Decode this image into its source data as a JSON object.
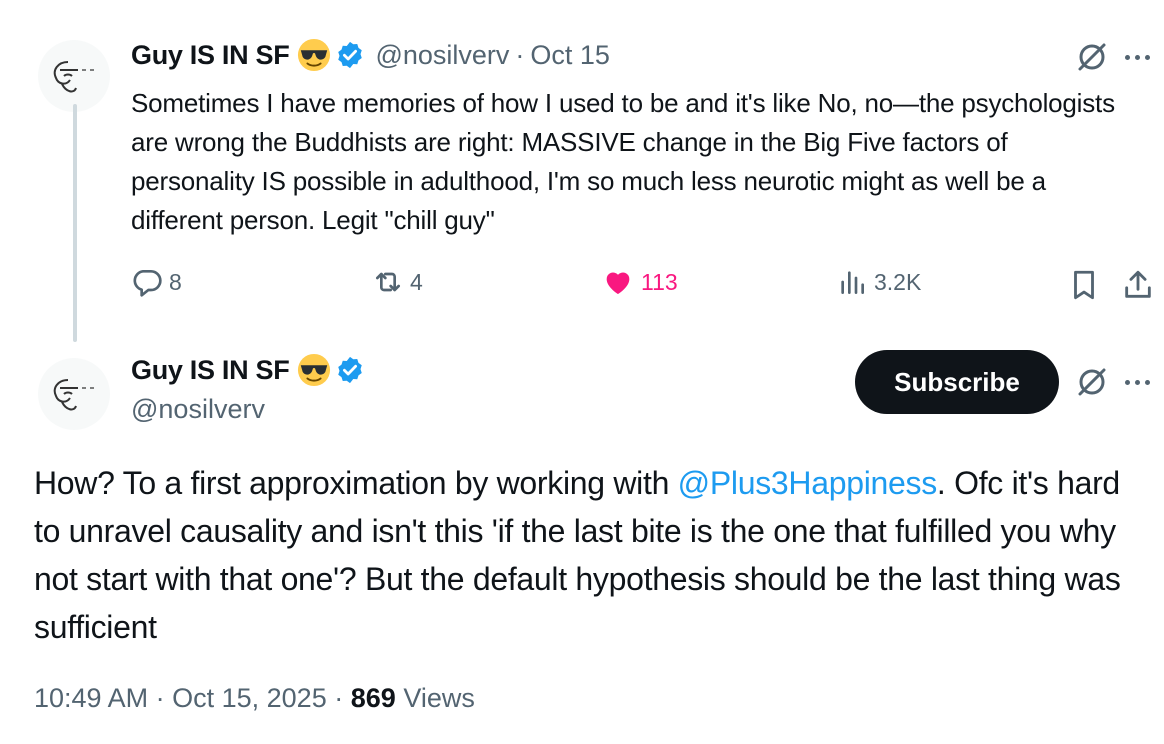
{
  "tweet1": {
    "display_name": "Guy IS IN SF",
    "handle": "@nosilverv",
    "separator": "·",
    "date": "Oct 15",
    "text": "Sometimes I have memories of how I used to be and it's like No, no—the psychologists are wrong the Buddhists are right: MASSIVE change in the Big Five factors of personality IS possible in adulthood, I'm so much less neurotic might as well be a different person. Legit \"chill guy\"",
    "replies": "8",
    "reposts": "4",
    "likes": "113",
    "views": "3.2K"
  },
  "tweet2": {
    "display_name": "Guy IS IN SF",
    "handle": "@nosilverv",
    "subscribe_label": "Subscribe",
    "text_before": "How? To a first approximation by working with ",
    "mention": "@Plus3Happiness",
    "text_after": ". Ofc it's hard to unravel causality and isn't this 'if the last bite is the one that fulfilled you why not start with that one'? But the default hypothesis should be the last thing was sufficient",
    "time": "10:49 AM",
    "separator": "·",
    "full_date": "Oct 15, 2025",
    "view_count": "869",
    "views_label": "Views"
  },
  "colors": {
    "accent": "#1d9bf0",
    "like": "#f91880",
    "muted": "#536471",
    "text": "#0f1419"
  },
  "icons": [
    "avatar-sketch",
    "sunglasses-emoji-icon",
    "verified-badge-icon",
    "grok-icon",
    "more-icon",
    "reply-icon",
    "repost-icon",
    "heart-icon",
    "views-icon",
    "bookmark-icon",
    "share-icon"
  ]
}
